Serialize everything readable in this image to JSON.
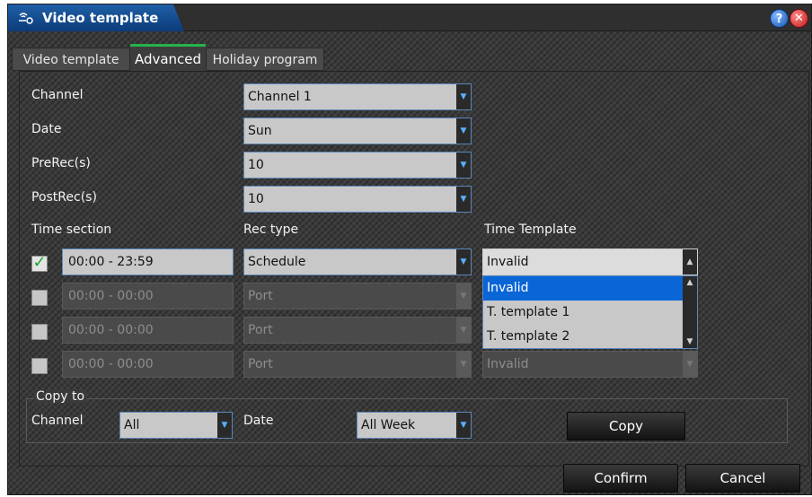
{
  "window": {
    "title": "Video template",
    "title_icon": "signal-icon",
    "help_label": "?",
    "close_label": "✕"
  },
  "tabs": [
    {
      "label": "Video template",
      "active": false
    },
    {
      "label": "Advanced",
      "active": true
    },
    {
      "label": "Holiday program",
      "active": false
    }
  ],
  "form": {
    "channel_label": "Channel",
    "channel_value": "Channel 1",
    "date_label": "Date",
    "date_value": "Sun",
    "prerec_label": "PreRec(s)",
    "prerec_value": "10",
    "postrec_label": "PostRec(s)",
    "postrec_value": "10"
  },
  "sections": {
    "col_time": "Time section",
    "col_rectype": "Rec type",
    "col_template": "Time Template",
    "rows": [
      {
        "checked": true,
        "time": "00:00 - 23:59",
        "rec_type": "Schedule",
        "template": "Invalid",
        "enabled": true
      },
      {
        "checked": false,
        "time": "00:00 - 00:00",
        "rec_type": "Port",
        "template": "",
        "enabled": false
      },
      {
        "checked": false,
        "time": "00:00 - 00:00",
        "rec_type": "Port",
        "template": "",
        "enabled": false
      },
      {
        "checked": false,
        "time": "00:00 - 00:00",
        "rec_type": "Port",
        "template": "Invalid",
        "enabled": false
      }
    ]
  },
  "template_dropdown": {
    "options": [
      "Invalid",
      "T. template 1",
      "T. template 2"
    ],
    "selected": "Invalid"
  },
  "copy_to": {
    "legend": "Copy to",
    "channel_label": "Channel",
    "channel_value": "All",
    "date_label": "Date",
    "date_value": "All Week",
    "copy_button": "Copy"
  },
  "footer": {
    "confirm": "Confirm",
    "cancel": "Cancel"
  },
  "icons": {
    "dropdown_arrow": "▼",
    "scroll_up": "▲",
    "scroll_down": "▼",
    "check": "✓"
  },
  "colors": {
    "accent_tab": "#27b24a",
    "title_blue": "#1f5fa6",
    "selection_blue": "#0a66d6",
    "field_border": "#5c87b8"
  }
}
